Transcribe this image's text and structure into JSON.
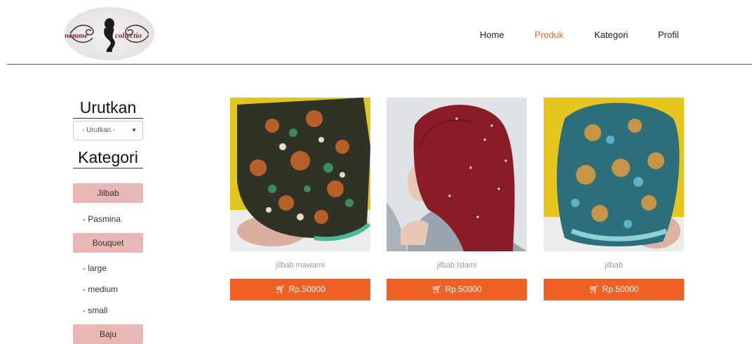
{
  "nav": {
    "items": [
      "Home",
      "Produk",
      "Kategori",
      "Profil"
    ],
    "active": "Produk",
    "accent_color": "#e8682c"
  },
  "logo": {
    "text": "nemme collectio"
  },
  "sidebar": {
    "sort_heading": "Urutkan",
    "sort_select_value": "- Urutkan -",
    "category_heading": "Kategori",
    "categories": [
      {
        "label": "Jilbab",
        "subs": [
          "- Pasmina"
        ]
      },
      {
        "label": "Bouquet",
        "subs": [
          "- large",
          "- medium",
          "- small"
        ]
      },
      {
        "label": "Baju",
        "subs": []
      }
    ],
    "category_button_color": "#e8b7b6"
  },
  "products": [
    {
      "name": "jilbab mawarni",
      "price": "Rp.50000",
      "image": "batik-scarf-green-orange"
    },
    {
      "name": "jilbab islami",
      "price": "Rp.50000",
      "image": "maroon-hijab"
    },
    {
      "name": "jilbab",
      "price": "Rp.50000",
      "image": "batik-scarf-teal"
    }
  ],
  "buy_button_color": "#ee6023",
  "cart_icon": "cart-icon"
}
